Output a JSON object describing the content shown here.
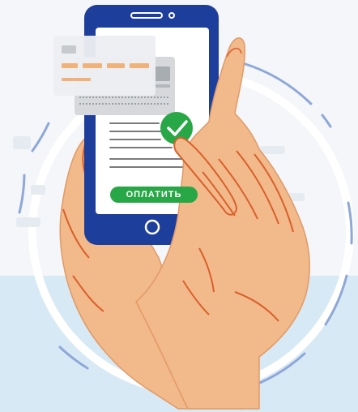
{
  "payment_screen": {
    "pay_button_label": "ОПЛАТИТЬ"
  },
  "icons": {
    "confirm": "checkmark-icon",
    "home": "home-button-icon",
    "speaker": "speaker-icon",
    "camera": "camera-icon"
  },
  "colors": {
    "phone_body": "#1e3e9c",
    "screen": "#ffffff",
    "accent_green": "#27a745",
    "card_orange": "#f1b27a",
    "skin": "#f2b98a",
    "skin_line": "#d9602d",
    "ring_blue": "#8ea8d8",
    "background_blue": "#d8e9f6"
  }
}
